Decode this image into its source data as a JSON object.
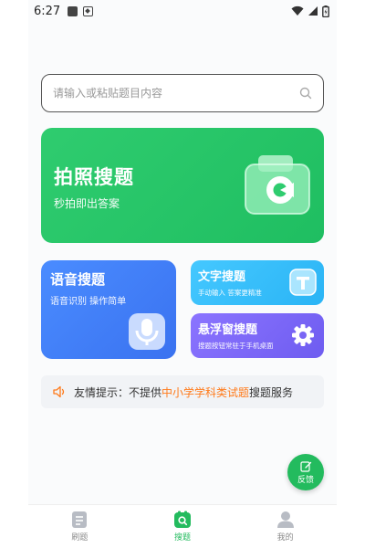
{
  "status_bar": {
    "time": "6:27"
  },
  "search": {
    "placeholder": "请输入或粘贴题目内容"
  },
  "main_card": {
    "title": "拍照搜题",
    "subtitle": "秒拍即出答案"
  },
  "voice_card": {
    "title": "语音搜题",
    "subtitle": "语音识别 操作简单"
  },
  "text_card": {
    "title": "文字搜题",
    "subtitle": "手动输入 答案更精准"
  },
  "float_card": {
    "title": "悬浮窗搜题",
    "subtitle": "搜题按钮常驻于手机桌面"
  },
  "tip": {
    "prefix": "友情提示：不提供",
    "highlight": "中小学学科类试题",
    "suffix": "搜题服务"
  },
  "fab": {
    "label": "反馈"
  },
  "tabs": [
    {
      "label": "刷题",
      "icon": "document-icon"
    },
    {
      "label": "搜题",
      "icon": "search-tab-icon",
      "active": true
    },
    {
      "label": "我的",
      "icon": "person-icon"
    }
  ],
  "colors": {
    "primary": "#23bb5e",
    "voice": "#4a8cff",
    "text": "#45c8ff",
    "float": "#8b74ff",
    "highlight": "#ff7a1a"
  }
}
